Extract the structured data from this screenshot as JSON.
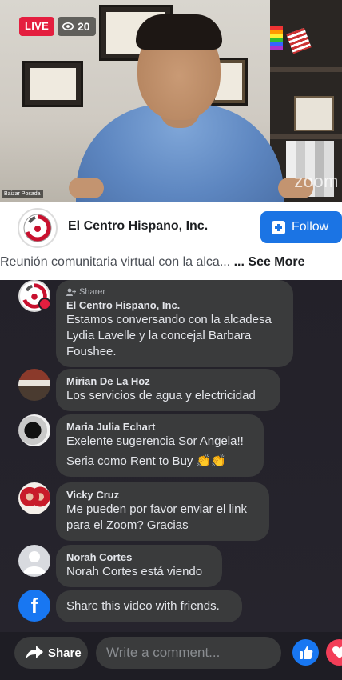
{
  "live": {
    "badge": "LIVE",
    "viewers": "20"
  },
  "video": {
    "watermark": "zoom",
    "name_tag": "Baizar Posada"
  },
  "page": {
    "name": "El Centro Hispano, Inc.",
    "follow_label": "Follow",
    "description": "Reunión comunitaria virtual con la alca...",
    "see_more": "... See More"
  },
  "comments": [
    {
      "badge": "Sharer",
      "name": "El Centro Hispano, Inc.",
      "text": "Estamos conversando con la alcadesa Lydia Lavelle y la concejal Barbara Foushee."
    },
    {
      "name": "Mirian De La Hoz",
      "text": "Los servicios de agua y electricidad"
    },
    {
      "name": "Maria Julia Echart",
      "text": "Exelente sugerencia Sor Angela!!",
      "text2": "Seria como Rent to Buy",
      "emoji": "👏👏"
    },
    {
      "name": "Vicky Cruz",
      "text": "Me pueden por favor enviar el link para el Zoom? Gracias"
    },
    {
      "name": "Norah Cortes",
      "text": "Norah Cortes está viendo"
    }
  ],
  "share_prompt": "Share this video with friends.",
  "bottom": {
    "share_label": "Share",
    "comment_placeholder": "Write a comment..."
  },
  "colors": {
    "live": "#e41e3f",
    "follow": "#1b74e4",
    "facebook_blue": "#1877f2",
    "love": "#f33e58",
    "bubble": "#3a3b3c"
  }
}
